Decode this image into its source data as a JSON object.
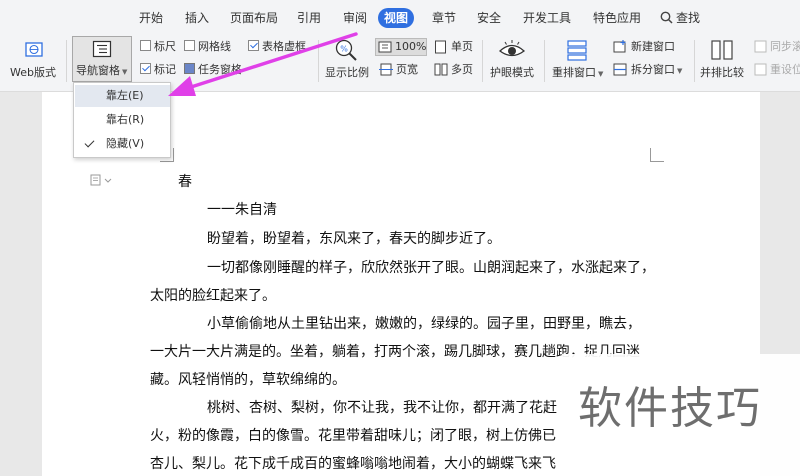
{
  "menu": {
    "items": [
      "开始",
      "插入",
      "页面布局",
      "引用",
      "审阅",
      "视图",
      "章节",
      "安全",
      "开发工具",
      "特色应用"
    ],
    "active": "视图",
    "search_label": "查找"
  },
  "ribbon": {
    "web_layout": "Web版式",
    "nav_pane": "导航窗格",
    "ruler": "标尺",
    "gridlines": "网格线",
    "table_dashed": "表格虚框",
    "markers": "标记",
    "task_pane": "任务窗格",
    "zoom_ratio": "显示比例",
    "zoom_100": "100%",
    "page_width": "页宽",
    "single_page": "单页",
    "multi_page": "多页",
    "eye_mode": "护眼模式",
    "rearrange_windows": "重排窗口",
    "new_window": "新建窗口",
    "split_window": "拆分窗口",
    "side_by_side": "并排比较",
    "sync_scroll": "同步滚",
    "reset_position": "重设位"
  },
  "checkbox_state": {
    "ruler": false,
    "gridlines": false,
    "table_dashed": true,
    "markers": true,
    "task_pane": true
  },
  "dropdown": {
    "items": [
      "靠左(E)",
      "靠右(R)",
      "隐藏(V)"
    ],
    "hover_index": 0,
    "checked_index": 2
  },
  "document": {
    "lines": [
      "春",
      "一一朱自清",
      "盼望着，盼望着，东风来了，春天的脚步近了。",
      "一切都像刚睡醒的样子，欣欣然张开了眼。山朗润起来了，水涨起来了，",
      "太阳的脸红起来了。",
      "小草偷偷地从土里钻出来，嫩嫩的，绿绿的。园子里，田野里，瞧去，",
      "一大片一大片满是的。坐着，躺着，打两个滚，踢几脚球，赛几趟跑，捉几回迷",
      "藏。风轻悄悄的，草软绵绵的。",
      "桃树、杏树、梨树，你不让我，我不让你，都开满了花赶",
      "火，粉的像霞，白的像雪。花里带着甜味儿；闭了眼，树上仿佛已",
      "杏儿、梨儿。花下成千成百的蜜蜂嗡嗡地闹着，大小的蝴蝶飞来飞"
    ]
  },
  "watermark": "软件技巧",
  "colors": {
    "accent": "#2f6fe0",
    "arrow": "#e040e8",
    "toolbar_bg": "#f3f4f6"
  }
}
